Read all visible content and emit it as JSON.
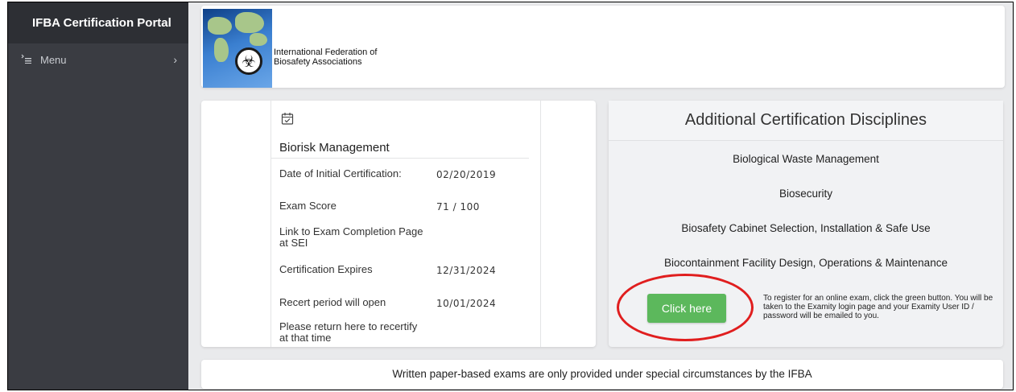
{
  "sidebar": {
    "title": "IFBA Certification Portal",
    "menu_label": "Menu",
    "menu_icon": "menu-list-icon",
    "chevron": "›"
  },
  "header": {
    "org_line1": "International Federation of",
    "org_line2": "Biosafety Associations"
  },
  "certification": {
    "icon": "calendar-check-icon",
    "title": "Biorisk Management",
    "rows": [
      {
        "label": "Date of Initial Certification:",
        "value": "02/20/2019"
      },
      {
        "label": "Exam Score",
        "value": "71 / 100"
      },
      {
        "label": "Link to Exam Completion Page at SEI",
        "value": ""
      },
      {
        "label": "Certification Expires",
        "value": "12/31/2024"
      },
      {
        "label": "Recert period will open",
        "value": "10/01/2024"
      },
      {
        "label": "Please return here to recertify at that time",
        "value": ""
      }
    ]
  },
  "disciplines": {
    "title": "Additional Certification Disciplines",
    "items": [
      "Biological Waste Management",
      "Biosecurity",
      "Biosafety Cabinet Selection, Installation & Safe Use",
      "Biocontainment Facility Design, Operations & Maintenance"
    ],
    "button_label": "Click here",
    "register_note": "To register for an online exam, click the green button. You will be taken to the Examity login page and your Examity User ID / password will be emailed to you.",
    "colors": {
      "button": "#5cb85c",
      "highlight_ring": "#e01e1e"
    }
  },
  "footer": {
    "text": "Written paper-based exams are only provided under special circumstances by the IFBA"
  }
}
